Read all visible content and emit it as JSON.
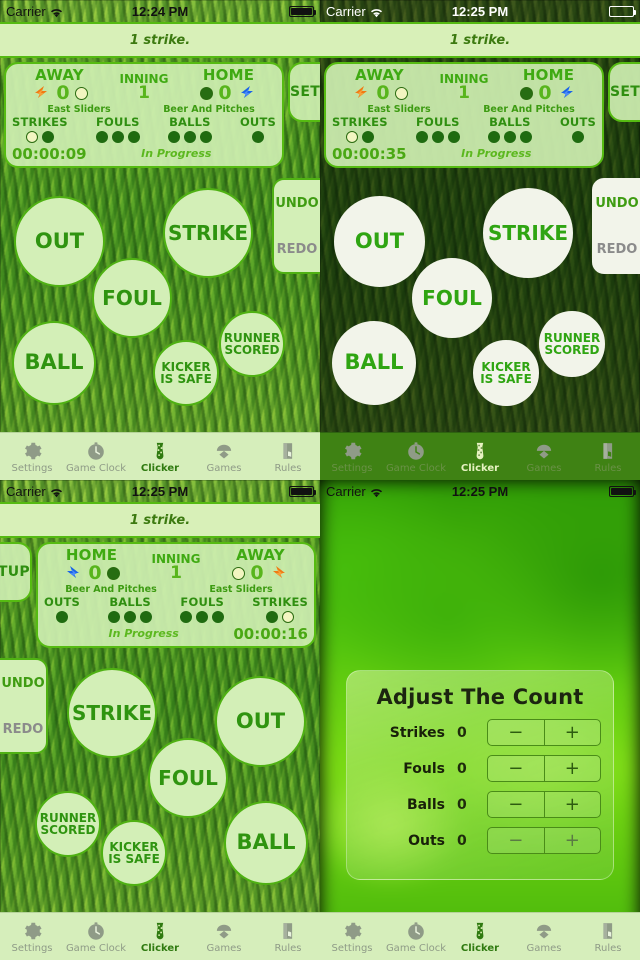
{
  "app": {
    "banner_text": "1 strike.",
    "setup_label": "SETUP",
    "undo_label": "UNDO",
    "redo_label": "REDO",
    "status_text": "In Progress",
    "colors": {
      "accent_green": "#4fb113",
      "button_fill": "#d3efb7",
      "button_fill_white": "#f2f4ea",
      "text_green": "#2f9410",
      "disabled_gray": "#8b8b8b",
      "board_fill": "#ceeeb0",
      "tabbar_light": "#d6eebb",
      "tabbar_dark": "#3f8214"
    }
  },
  "tabs": [
    {
      "label": "Settings",
      "icon": "gear-icon",
      "active": false
    },
    {
      "label": "Game Clock",
      "icon": "stopwatch-icon",
      "active": false
    },
    {
      "label": "Clicker",
      "icon": "clicker-icon",
      "active": true
    },
    {
      "label": "Games",
      "icon": "baseball-diamond-icon",
      "active": false
    },
    {
      "label": "Rules",
      "icon": "book-icon",
      "active": false
    }
  ],
  "clicker_buttons": [
    {
      "label": "OUT"
    },
    {
      "label": "STRIKE"
    },
    {
      "label": "FOUL"
    },
    {
      "label": "BALL"
    },
    {
      "label": "RUNNER SCORED",
      "line1": "RUNNER",
      "line2": "SCORED"
    },
    {
      "label": "KICKER IS SAFE",
      "line1": "KICKER",
      "line2": "IS SAFE"
    }
  ],
  "panels": [
    {
      "id": "panel-1",
      "statusbar": {
        "carrier": "Carrier",
        "time": "12:24 PM",
        "battery": "full",
        "style": "dark-text"
      },
      "board": {
        "left": {
          "title": "AWAY",
          "score": "0",
          "team_name": "East Sliders",
          "possession": "on",
          "bolt_color": "#f07a14"
        },
        "right": {
          "title": "HOME",
          "score": "0",
          "team_name": "Beer And Pitches",
          "possession": "off",
          "bolt_color": "#1a63e8"
        },
        "inning_label": "INNING",
        "inning_value": "1",
        "counts": [
          {
            "label": "STRIKES",
            "total": 2,
            "active_index": 0
          },
          {
            "label": "FOULS",
            "total": 3,
            "active_index": -1
          },
          {
            "label": "BALLS",
            "total": 3,
            "active_index": -1
          },
          {
            "label": "OUTS",
            "total": 1,
            "active_index": -1
          }
        ],
        "timer": "00:00:09",
        "status": "In Progress",
        "layout": "ltr"
      }
    },
    {
      "id": "panel-2",
      "statusbar": {
        "carrier": "Carrier",
        "time": "12:25 PM",
        "battery": "empty-outline",
        "style": "light-text"
      },
      "board": {
        "left": {
          "title": "AWAY",
          "score": "0",
          "team_name": "East Sliders",
          "possession": "on",
          "bolt_color": "#f07a14"
        },
        "right": {
          "title": "HOME",
          "score": "0",
          "team_name": "Beer And Pitches",
          "possession": "off",
          "bolt_color": "#1a63e8"
        },
        "inning_label": "INNING",
        "inning_value": "1",
        "counts": [
          {
            "label": "STRIKES",
            "total": 2,
            "active_index": 0
          },
          {
            "label": "FOULS",
            "total": 3,
            "active_index": -1
          },
          {
            "label": "BALLS",
            "total": 3,
            "active_index": -1
          },
          {
            "label": "OUTS",
            "total": 1,
            "active_index": -1
          }
        ],
        "timer": "00:00:35",
        "status": "In Progress",
        "layout": "ltr"
      }
    },
    {
      "id": "panel-3",
      "statusbar": {
        "carrier": "Carrier",
        "time": "12:25 PM",
        "battery": "full",
        "style": "dark-text"
      },
      "board": {
        "left": {
          "title": "HOME",
          "score": "0",
          "team_name": "Beer And Pitches",
          "possession": "off",
          "bolt_color": "#1a63e8"
        },
        "right": {
          "title": "AWAY",
          "score": "0",
          "team_name": "East Sliders",
          "possession": "on",
          "bolt_color": "#f07a14"
        },
        "inning_label": "INNING",
        "inning_value": "1",
        "counts": [
          {
            "label": "OUTS",
            "total": 1,
            "active_index": -1
          },
          {
            "label": "BALLS",
            "total": 3,
            "active_index": -1
          },
          {
            "label": "FOULS",
            "total": 3,
            "active_index": -1
          },
          {
            "label": "STRIKES",
            "total": 2,
            "active_index": 1
          }
        ],
        "timer": "00:00:16",
        "status": "In Progress",
        "layout": "rtl"
      }
    },
    {
      "id": "panel-4",
      "statusbar": {
        "carrier": "Carrier",
        "time": "12:25 PM",
        "battery": "full",
        "style": "dark-text"
      }
    }
  ],
  "dialog": {
    "title": "Adjust The Count",
    "minus_label": "−",
    "plus_label": "+",
    "rows": [
      {
        "label": "Strikes",
        "value": "0",
        "dim": false
      },
      {
        "label": "Fouls",
        "value": "0",
        "dim": false
      },
      {
        "label": "Balls",
        "value": "0",
        "dim": false
      },
      {
        "label": "Outs",
        "value": "0",
        "dim": true
      }
    ]
  }
}
